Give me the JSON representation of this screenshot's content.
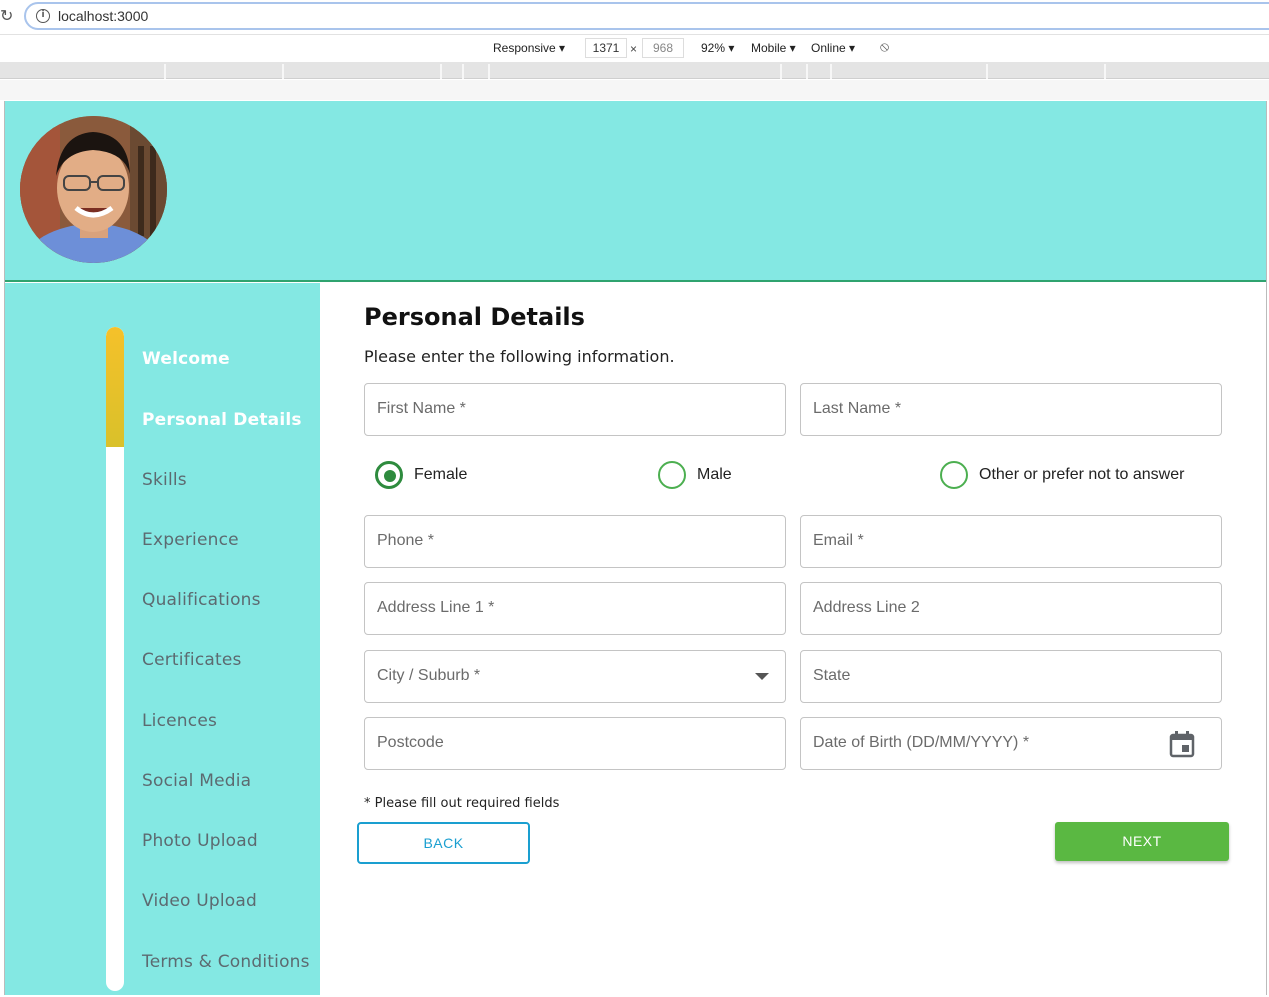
{
  "browser": {
    "url": "localhost:3000",
    "device": "Responsive ▾",
    "width": "1371",
    "height": "968",
    "zoom": "92% ▾",
    "mode": "Mobile ▾",
    "network": "Online ▾"
  },
  "sidebar": {
    "progress_fraction": 0.18,
    "items": [
      {
        "label": "Welcome",
        "done": true
      },
      {
        "label": "Personal Details",
        "done": true
      },
      {
        "label": "Skills",
        "done": false
      },
      {
        "label": "Experience",
        "done": false
      },
      {
        "label": "Qualifications",
        "done": false
      },
      {
        "label": "Certificates",
        "done": false
      },
      {
        "label": "Licences",
        "done": false
      },
      {
        "label": "Social Media",
        "done": false
      },
      {
        "label": "Photo Upload",
        "done": false
      },
      {
        "label": "Video Upload",
        "done": false
      },
      {
        "label": "Terms & Conditions",
        "done": false
      }
    ]
  },
  "form": {
    "title": "Personal Details",
    "subtitle": "Please enter the following information.",
    "first_name": "First Name *",
    "last_name": "Last Name *",
    "gender": {
      "selected": "Female",
      "options": [
        "Female",
        "Male",
        "Other or prefer not to answer"
      ]
    },
    "phone": "Phone *",
    "email": "Email *",
    "address1": "Address Line 1 *",
    "address2": "Address Line 2",
    "city": "City / Suburb *",
    "state": "State",
    "postcode": "Postcode",
    "dob": "Date of Birth (DD/MM/YYYY) *",
    "required_note": "* Please fill out required fields",
    "back_label": "BACK",
    "next_label": "NEXT"
  },
  "colors": {
    "accent_teal": "#84e8e3",
    "progress_yellow": "#f5c12a",
    "radio_green": "#2e8b3e",
    "next_green": "#5ab842",
    "back_blue": "#1a9fd0"
  }
}
